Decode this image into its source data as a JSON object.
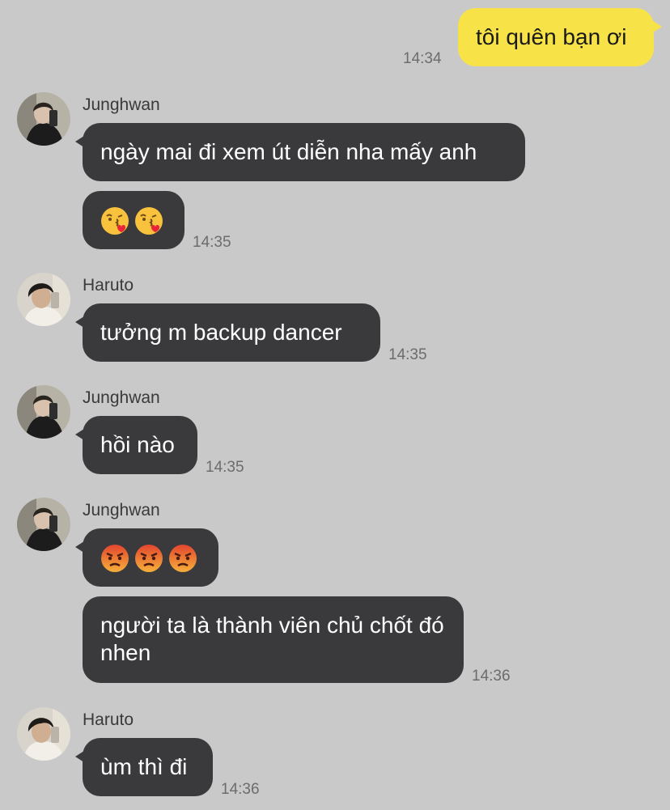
{
  "messages": {
    "m1": {
      "text": "tôi quên bạn ơi",
      "time": "14:34"
    },
    "m2": {
      "sender": "Junghwan",
      "text": "ngày mai đi xem út diễn nha mấy anh"
    },
    "m3": {
      "emoji": [
        "kissing-heart-emoji",
        "kissing-heart-emoji"
      ],
      "time": "14:35"
    },
    "m4": {
      "sender": "Haruto",
      "text": "tưởng m backup dancer",
      "time": "14:35"
    },
    "m5": {
      "sender": "Junghwan",
      "text": "hồi nào",
      "time": "14:35"
    },
    "m6": {
      "sender": "Junghwan",
      "emoji": [
        "angry-face-emoji",
        "angry-face-emoji",
        "angry-face-emoji"
      ]
    },
    "m7": {
      "text": "người ta là thành viên chủ chốt đó nhen",
      "time": "14:36"
    },
    "m8": {
      "sender": "Haruto",
      "text": "ùm thì đi",
      "time": "14:36"
    }
  },
  "colors": {
    "background": "#c9c9c9",
    "incoming_bubble": "#3a3a3c",
    "outgoing_bubble": "#f7e348"
  }
}
